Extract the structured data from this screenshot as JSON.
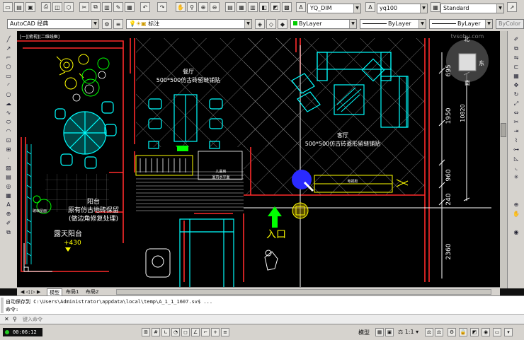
{
  "toolbar": {
    "dim_style": "YQ_DIM",
    "text_style": "yq100",
    "table_style": "Standard",
    "workspace": "AutoCAD 经典",
    "layer": "标注",
    "color": "ByLayer",
    "linetype": "ByLayer",
    "lineweight": "ByLayer",
    "plotstyle": "ByColor"
  },
  "viewport_label": "[一][俯视][二维线框]",
  "watermark": "tvsohu.com",
  "viewcube": {
    "north": "北",
    "east": "东",
    "south": "南"
  },
  "drawing": {
    "dining_name": "餐厅",
    "dining_spec": "500*500仿古砖留缝铺贴",
    "living_name": "客厅",
    "living_spec": "500*500仿古砖菱形留缝铺贴",
    "balcony_name": "阳台",
    "balcony_spec_1": "原有仿古地砖保留",
    "balcony_spec_2": "(做边角修复处理)",
    "terrace_name": "露天阳台",
    "level_mark": "+430",
    "entry_label": "入口",
    "cabinet_note_1": "儿童房",
    "cabinet_note_2": "室内水平面",
    "tv_label": "电视柜",
    "dims": [
      "695",
      "1950",
      "960",
      "240",
      "2360"
    ],
    "dim_side": "10820",
    "tree_note": "玻璃屋面"
  },
  "tabs": [
    "模型",
    "布局1",
    "布局2"
  ],
  "command": {
    "line1": "自动保存到 C:\\Users\\Administrator\\appdata\\local\\temp\\A_1_1_1607.sv$ ...",
    "line2": "命令:",
    "placeholder": "键入命令"
  },
  "status": {
    "time": "00:06:12",
    "model_label": "模型",
    "scale": "1:1"
  },
  "colors": {
    "wall": "#ff2a2a",
    "furniture": "#00ffff",
    "text": "#ffffff",
    "hatch": "#c8c8c8",
    "cursor": "#2a2aff",
    "entry_arrow": "#00ff00",
    "yellow": "#ffff00"
  }
}
